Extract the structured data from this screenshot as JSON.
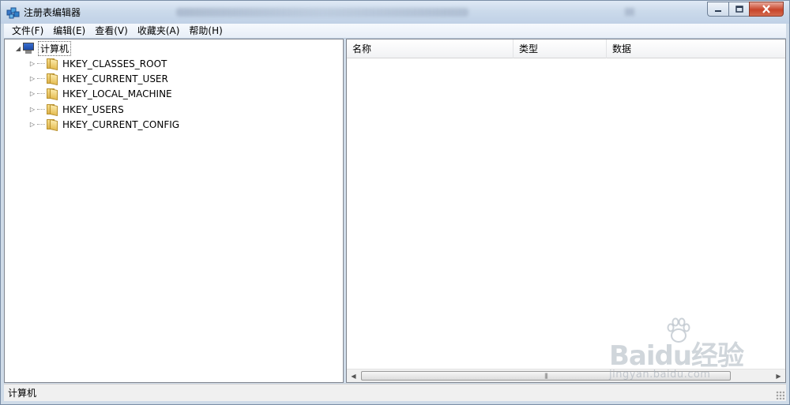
{
  "window": {
    "title": "注册表编辑器",
    "caption_buttons": [
      "minimize-icon",
      "maximize-icon",
      "close-icon"
    ]
  },
  "menu": [
    "文件(F)",
    "编辑(E)",
    "查看(V)",
    "收藏夹(A)",
    "帮助(H)"
  ],
  "tree": {
    "root": "计算机",
    "items": [
      "HKEY_CLASSES_ROOT",
      "HKEY_CURRENT_USER",
      "HKEY_LOCAL_MACHINE",
      "HKEY_USERS",
      "HKEY_CURRENT_CONFIG"
    ]
  },
  "list": {
    "columns": [
      "名称",
      "类型",
      "数据"
    ]
  },
  "status": "计算机",
  "watermark": {
    "brand": "Baidu经验",
    "url": "jingyan.baidu.com"
  },
  "colors": {
    "titlebar": "#cbdaeb",
    "close_button": "#c7442a",
    "folder": "#e5bd53"
  }
}
